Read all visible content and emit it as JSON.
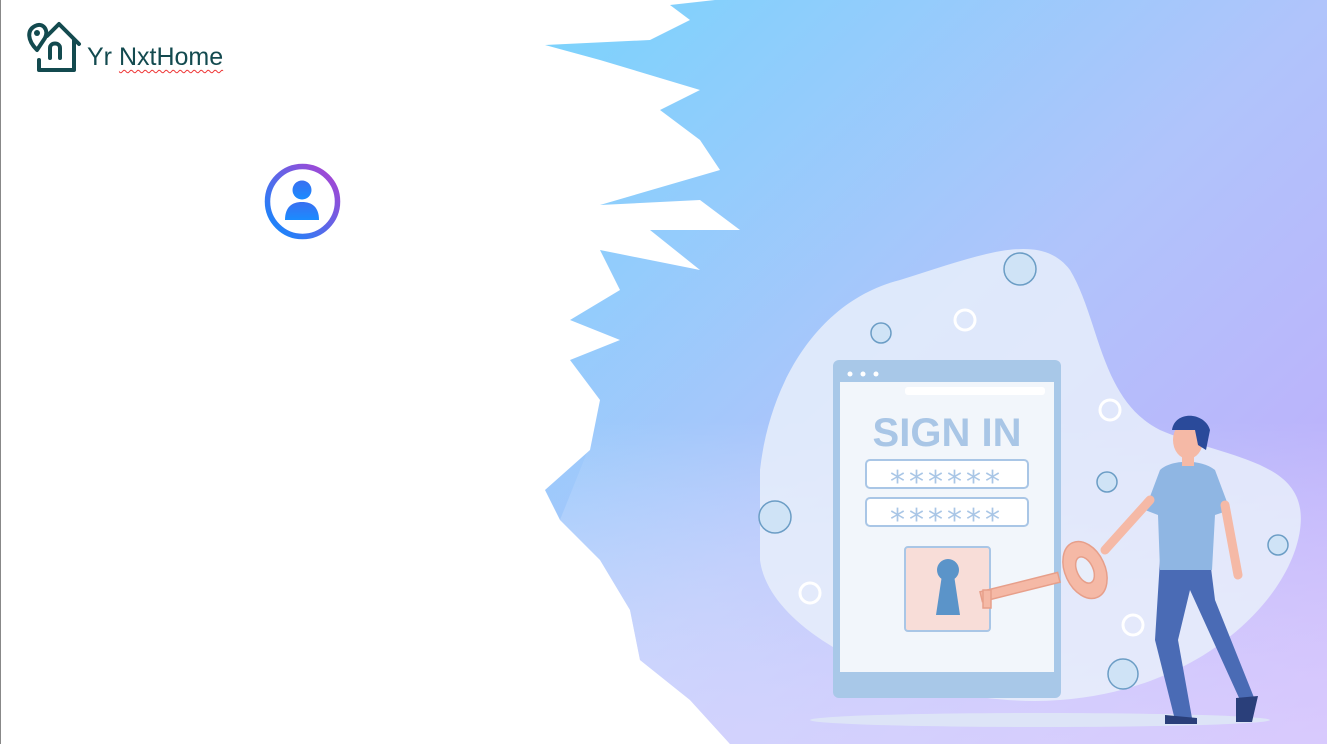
{
  "brand": {
    "name_prefix": "Yr",
    "name_main": "NxtHome"
  },
  "illustration": {
    "heading": "SIGN IN",
    "password_mask_1": "******",
    "password_mask_2": "******"
  },
  "colors": {
    "brand": "#134a4f",
    "avatar_gradient_start": "#0a8cff",
    "avatar_gradient_end": "#b33fd0",
    "bg_gradient_start": "#7ad0fb",
    "bg_gradient_end": "#c9a6fb"
  },
  "icons": {
    "logo": "location-home-icon",
    "avatar": "user-icon"
  }
}
